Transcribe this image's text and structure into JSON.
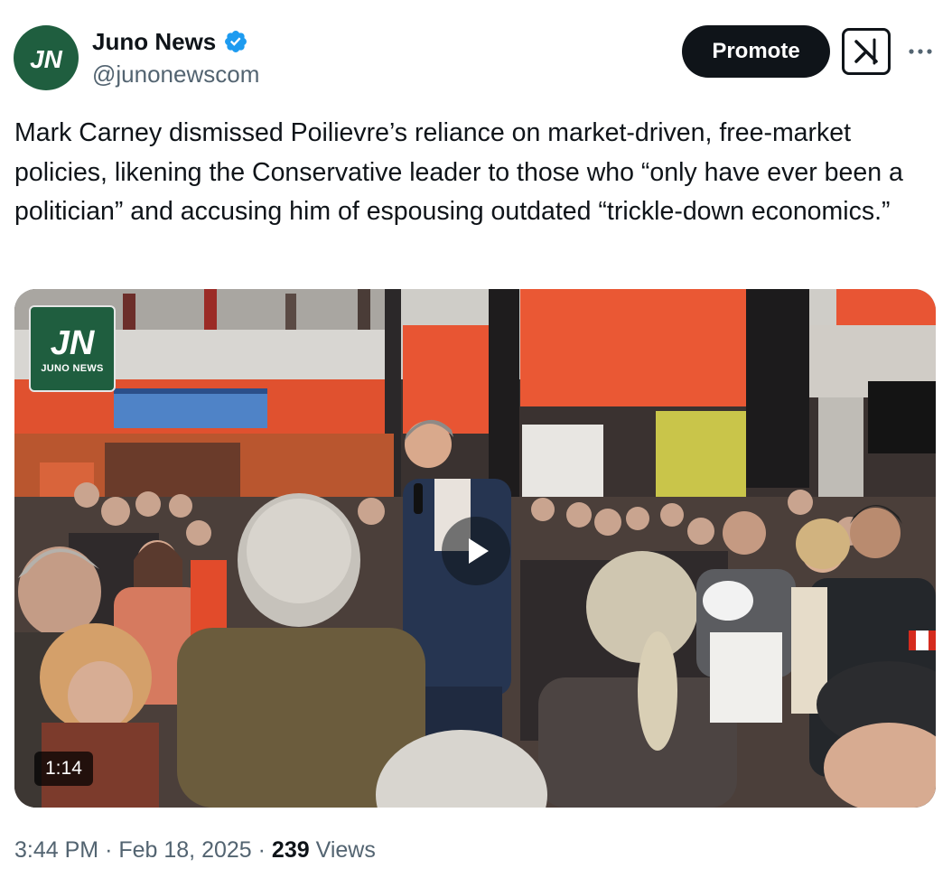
{
  "author": {
    "display_name": "Juno News",
    "handle": "@junonewscom",
    "avatar_icon": "juno-news-logo-icon",
    "verified_icon": "verified-badge-icon",
    "avatar_color": "#1f5e3f",
    "verified_color": "#1d9bf0"
  },
  "actions": {
    "promote_label": "Promote",
    "grok_icon": "grok-icon",
    "more_icon": "more-options-icon"
  },
  "tweet": {
    "text": "Mark Carney dismissed Poilievre’s reliance on market-driven, free-market policies, likening the Conservative leader to those who “only have ever been a politician” and accusing him of espousing outdated “trickle-down economics.”"
  },
  "media": {
    "watermark_text": "JUNO NEWS",
    "duration": "1:14",
    "play_icon": "play-icon"
  },
  "meta": {
    "time": "3:44 PM",
    "separator": "·",
    "date": "Feb 18, 2025",
    "views_count": "239",
    "views_label": "Views"
  }
}
